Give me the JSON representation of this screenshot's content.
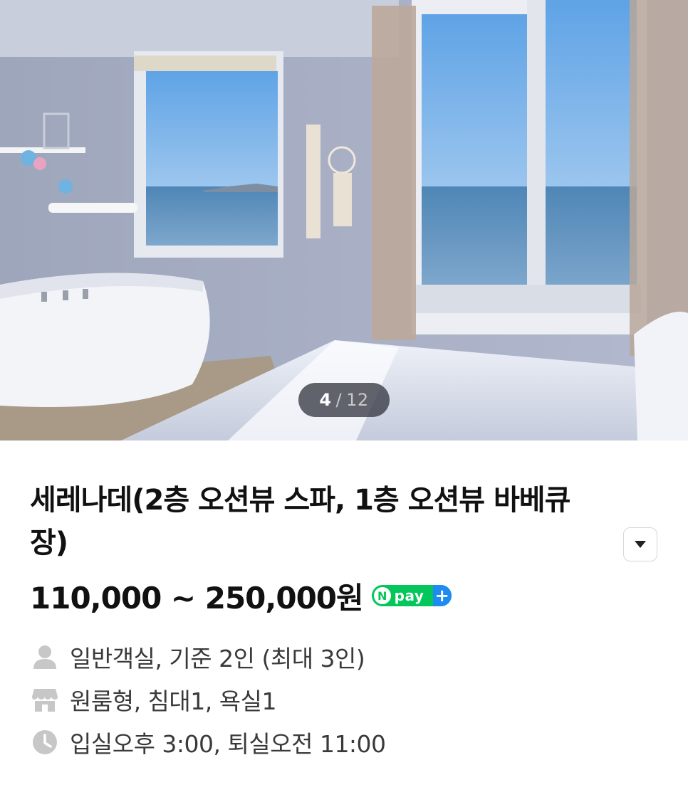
{
  "gallery": {
    "current": "4",
    "separator": "/",
    "total": "12"
  },
  "room": {
    "title": "세레나데(2층 오션뷰 스파, 1층 오션뷰 바베큐장)",
    "price": "110,000 ~ 250,000원",
    "npay_badge": {
      "n": "N",
      "pay": "pay",
      "plus": "+"
    },
    "details": [
      {
        "icon": "person-icon",
        "text": "일반객실, 기준 2인 (최대 3인)"
      },
      {
        "icon": "store-icon",
        "text": "원룸형, 침대1, 욕실1"
      },
      {
        "icon": "clock-icon",
        "text": "입실오후 3:00, 퇴실오전 11:00"
      }
    ]
  },
  "colors": {
    "npay_green": "#03c75a",
    "npay_blue": "#1e8bf0",
    "icon_gray": "#c7c7c7"
  }
}
